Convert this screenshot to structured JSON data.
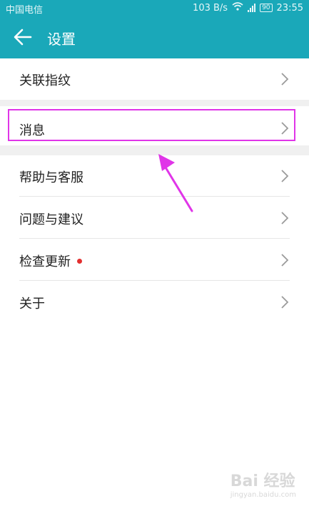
{
  "status_bar": {
    "carrier": "中国电信",
    "network_speed": "103 B/s",
    "battery": "90",
    "time": "23:55"
  },
  "toolbar": {
    "back_icon": "arrow-left-icon",
    "title": "设置"
  },
  "menu": {
    "items": [
      {
        "label": "关联指纹"
      },
      {
        "label": "消息"
      },
      {
        "label": "帮助与客服"
      },
      {
        "label": "问题与建议"
      },
      {
        "label": "检查更新",
        "badge": "red-dot"
      },
      {
        "label": "关于"
      }
    ]
  },
  "colors": {
    "accent": "#1aa8b9",
    "highlight": "#e035e8",
    "badge": "#e32f2f"
  },
  "watermark": {
    "text": "Bai 经验",
    "url": "jingyan.baidu.com"
  }
}
